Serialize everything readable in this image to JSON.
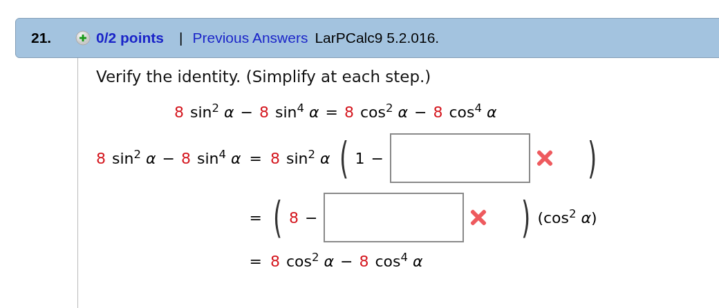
{
  "question": {
    "number": "21.",
    "points": "0/2 points",
    "separator": "|",
    "previous_answers": "Previous Answers",
    "source": "LarPCalc9 5.2.016."
  },
  "prompt": "Verify the identity. (Simplify at each step.)",
  "identity": [
    {
      "kind": "coef",
      "text": "8"
    },
    {
      "kind": "term",
      "text": "sin$^{2}$ *α*"
    },
    {
      "kind": "op",
      "text": "−"
    },
    {
      "kind": "coef",
      "text": "8"
    },
    {
      "kind": "term",
      "text": "sin$^{4}$ *α*"
    },
    {
      "kind": "op",
      "text": "="
    },
    {
      "kind": "coef",
      "text": "8"
    },
    {
      "kind": "term",
      "text": "cos$^{2}$ *α*"
    },
    {
      "kind": "op",
      "text": "−"
    },
    {
      "kind": "coef",
      "text": "8"
    },
    {
      "kind": "term",
      "text": "cos$^{4}$ *α*"
    }
  ],
  "steps": [
    {
      "lhs": [
        {
          "kind": "coef",
          "text": "8"
        },
        {
          "kind": "term",
          "text": "sin$^{2}$ *α*"
        },
        {
          "kind": "op",
          "text": "−"
        },
        {
          "kind": "coef",
          "text": "8"
        },
        {
          "kind": "term",
          "text": "sin$^{4}$ *α*"
        }
      ],
      "eq": "=",
      "rhs": [
        {
          "kind": "coef",
          "text": "8"
        },
        {
          "kind": "term",
          "text": "sin$^{2}$ *α*"
        },
        {
          "kind": "paren",
          "text": "("
        },
        {
          "kind": "term",
          "text": "1"
        },
        {
          "kind": "op",
          "text": "−"
        },
        {
          "kind": "answer",
          "correct": false
        },
        {
          "kind": "paren",
          "text": ")"
        }
      ]
    },
    {
      "eq": "=",
      "rhs": [
        {
          "kind": "paren",
          "text": "("
        },
        {
          "kind": "coef",
          "text": "8"
        },
        {
          "kind": "op",
          "text": "−"
        },
        {
          "kind": "answer",
          "correct": false
        },
        {
          "kind": "paren",
          "text": ")"
        },
        {
          "kind": "term",
          "text": "(cos$^{2}$ *α*)"
        }
      ]
    },
    {
      "eq": "=",
      "rhs": [
        {
          "kind": "coef",
          "text": "8"
        },
        {
          "kind": "term",
          "text": "cos$^{2}$ *α*"
        },
        {
          "kind": "op",
          "text": "−"
        },
        {
          "kind": "coef",
          "text": "8"
        },
        {
          "kind": "term",
          "text": "cos$^{4}$ *α*"
        }
      ]
    }
  ]
}
